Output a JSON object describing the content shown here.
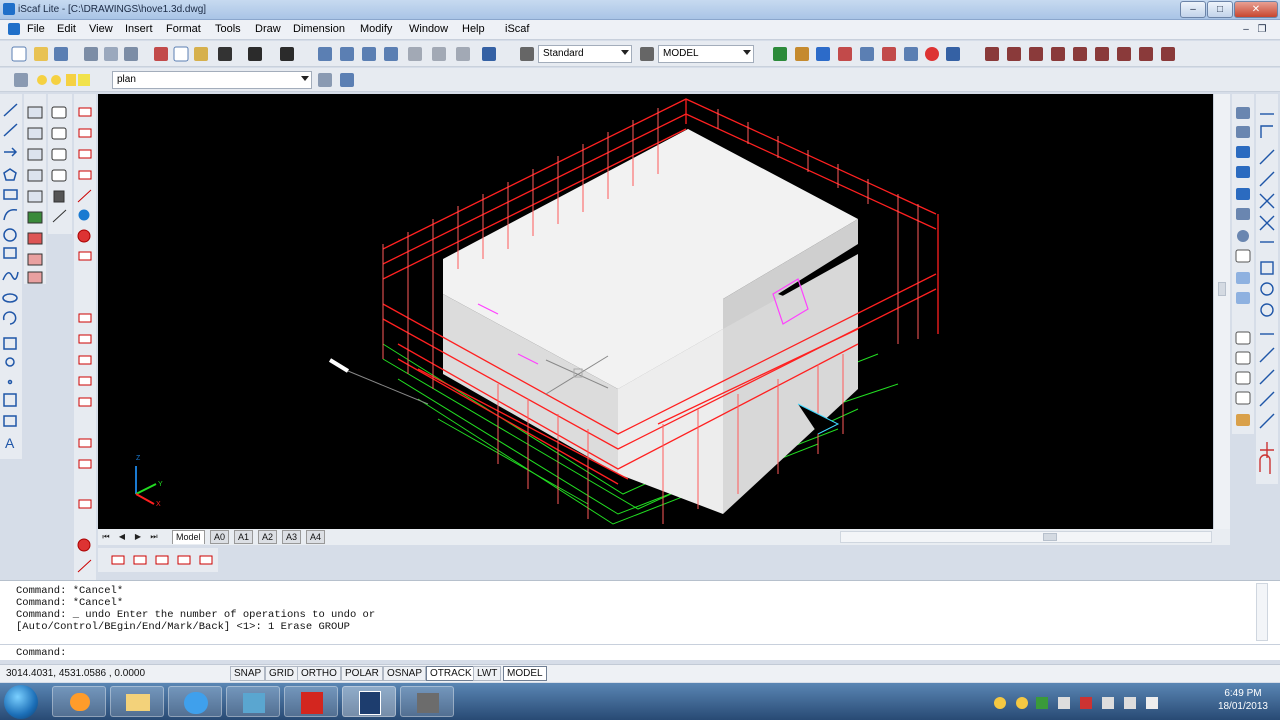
{
  "window": {
    "title": "iScaf Lite - [C:\\DRAWINGS\\hove1.3d.dwg]",
    "min": "–",
    "max": "□",
    "close": "✕"
  },
  "menu": [
    "File",
    "Edit",
    "View",
    "Insert",
    "Format",
    "Tools",
    "Draw",
    "Dimension",
    "Modify",
    "Window",
    "Help",
    "iScaf"
  ],
  "toolbar": {
    "textstyle": "Standard",
    "dimstyle": "MODEL",
    "layer": "plan"
  },
  "layout_tabs": [
    "Model",
    "A0",
    "A1",
    "A2",
    "A3",
    "A4"
  ],
  "command_lines": [
    "Command: *Cancel*",
    "Command: *Cancel*",
    "Command: _ undo Enter the number of operations to undo or",
    "[Auto/Control/BEgin/End/Mark/Back] <1>: 1 Erase GROUP"
  ],
  "command_prompt": "Command:",
  "status": {
    "coords": "3014.4031,  4531.0586 , 0.0000",
    "buttons": [
      "SNAP",
      "GRID",
      "ORTHO",
      "POLAR",
      "OSNAP",
      "OTRACK",
      "LWT",
      "MODEL"
    ],
    "active": [
      "OTRACK",
      "MODEL"
    ]
  },
  "clock": {
    "time": "6:49 PM",
    "date": "18/01/2013"
  },
  "ucs": {
    "x": "X",
    "y": "Y",
    "z": "Z"
  },
  "colors": {
    "scaffold_red": "#ff2020",
    "scaffold_green": "#22dd22",
    "building": "#f2f2f2",
    "magenta": "#ff40ff"
  }
}
